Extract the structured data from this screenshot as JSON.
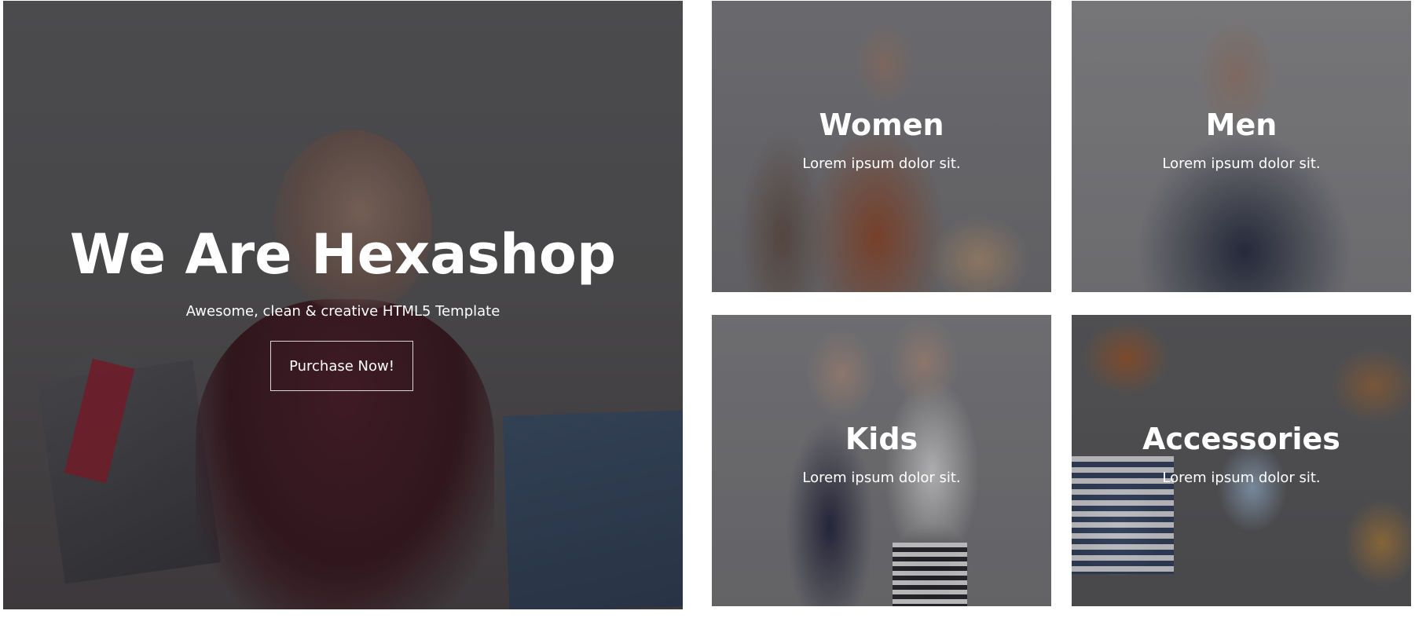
{
  "hero": {
    "title": "We Are Hexashop",
    "subtitle": "Awesome, clean & creative HTML5 Template",
    "button_label": "Purchase Now!"
  },
  "categories": [
    {
      "title": "Women",
      "text": "Lorem ipsum dolor sit."
    },
    {
      "title": "Men",
      "text": "Lorem ipsum dolor sit."
    },
    {
      "title": "Kids",
      "text": "Lorem ipsum dolor sit."
    },
    {
      "title": "Accessories",
      "text": "Lorem ipsum dolor sit."
    }
  ],
  "colors": {
    "background": "#ffffff",
    "text": "#ffffff",
    "button_border": "#d6d6d6"
  }
}
